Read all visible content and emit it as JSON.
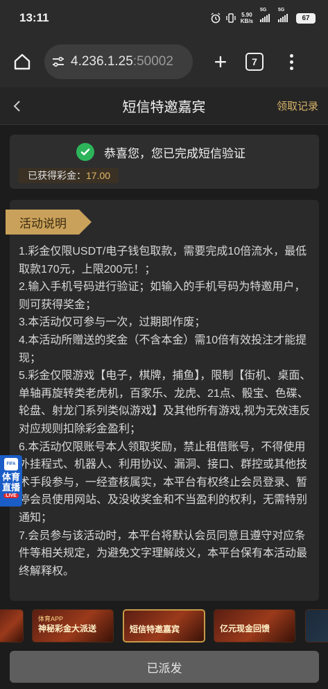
{
  "status_bar": {
    "time": "13:11",
    "net_speed_value": "5.90",
    "net_speed_unit": "KB/s",
    "sim1_label": "5G",
    "sim2_label": "5G",
    "battery": "67"
  },
  "browser": {
    "url_main": "4.236.1.25",
    "url_port": ":50002",
    "tab_count": "7"
  },
  "header": {
    "title": "短信特邀嘉宾",
    "record_link": "领取记录"
  },
  "verify": {
    "message": "恭喜您，您已完成短信验证",
    "reward_label": "已获得彩金：",
    "reward_amount": "17.00"
  },
  "rules": {
    "tag": "活动说明",
    "items": [
      "1.彩金仅限USDT/电子钱包取款，需要完成10倍流水，最低取款170元，上限200元！；",
      "2.输入手机号码进行验证；如输入的手机号码为特邀用户，则可获得奖金；",
      "3.本活动仅可参与一次，过期即作废；",
      "4.本活动所赠送的奖金（不含本金）需10倍有效投注才能提现；",
      "5.彩金仅限游戏【电子，棋牌，捕鱼】，限制【街机、桌面、单轴再旋转类老虎机，百家乐、龙虎、21点、骰宝、色碟、轮盘、射龙门系列类似游戏】及其他所有游戏,视为无效违反对应规则扣除彩金盈利；",
      "6.本活动仅限账号本人领取奖励，禁止租借账号，不得使用外挂程式、机器人、利用协议、漏洞、接口、群控或其他技术手段参与，一经查核属实，本平台有权终止会员登录、暂停会员使用网站、及没收奖金和不当盈利的权利，无需特别通知；",
      "7.会员参与该活动时，本平台将默认会员同意且遵守对应条件等相关规定，为避免文字理解歧义，本平台保有本活动最终解释权。"
    ]
  },
  "banners": [
    {
      "small": "",
      "big": ""
    },
    {
      "small": "体育APP",
      "big": "神秘彩金大派送"
    },
    {
      "small": "",
      "big": "短信特邀嘉宾"
    },
    {
      "small": "",
      "big": "亿元现金回馈"
    },
    {
      "small": "",
      "big": ""
    }
  ],
  "bottom": {
    "button": "已派发"
  },
  "live_badge": {
    "logo": "FIFA",
    "line1": "体育",
    "line2": "直播",
    "live": "LIVE"
  },
  "colors": {
    "accent_gold": "#d8b46a",
    "success_green": "#2db45a",
    "live_blue": "#1b5dc7"
  }
}
